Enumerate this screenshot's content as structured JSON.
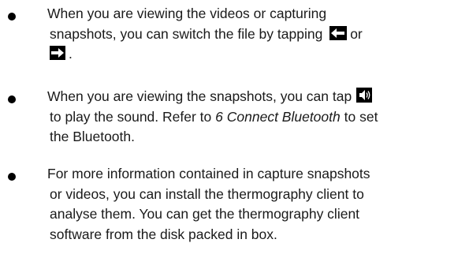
{
  "bullets": [
    {
      "lines": [
        "When you are viewing the videos or capturing",
        "snapshots, you can switch the file by tapping",
        "or",
        "."
      ],
      "icons": [
        "left-arrow-icon",
        "right-arrow-icon"
      ]
    },
    {
      "lines": [
        "When you are viewing the snapshots, you can tap",
        "to play the sound. Refer to",
        "6 Connect Bluetooth",
        "to set",
        "the Bluetooth."
      ],
      "icons": [
        "speaker-icon"
      ]
    },
    {
      "lines": [
        "For more information contained in capture snapshots",
        "or videos, you can install the thermography client to",
        "analyse them. You can get the thermography client",
        "software from the disk packed in box."
      ]
    }
  ],
  "colors": {
    "text": "#1a1a1a",
    "icon_bg": "#000000",
    "icon_fg": "#ffffff"
  }
}
